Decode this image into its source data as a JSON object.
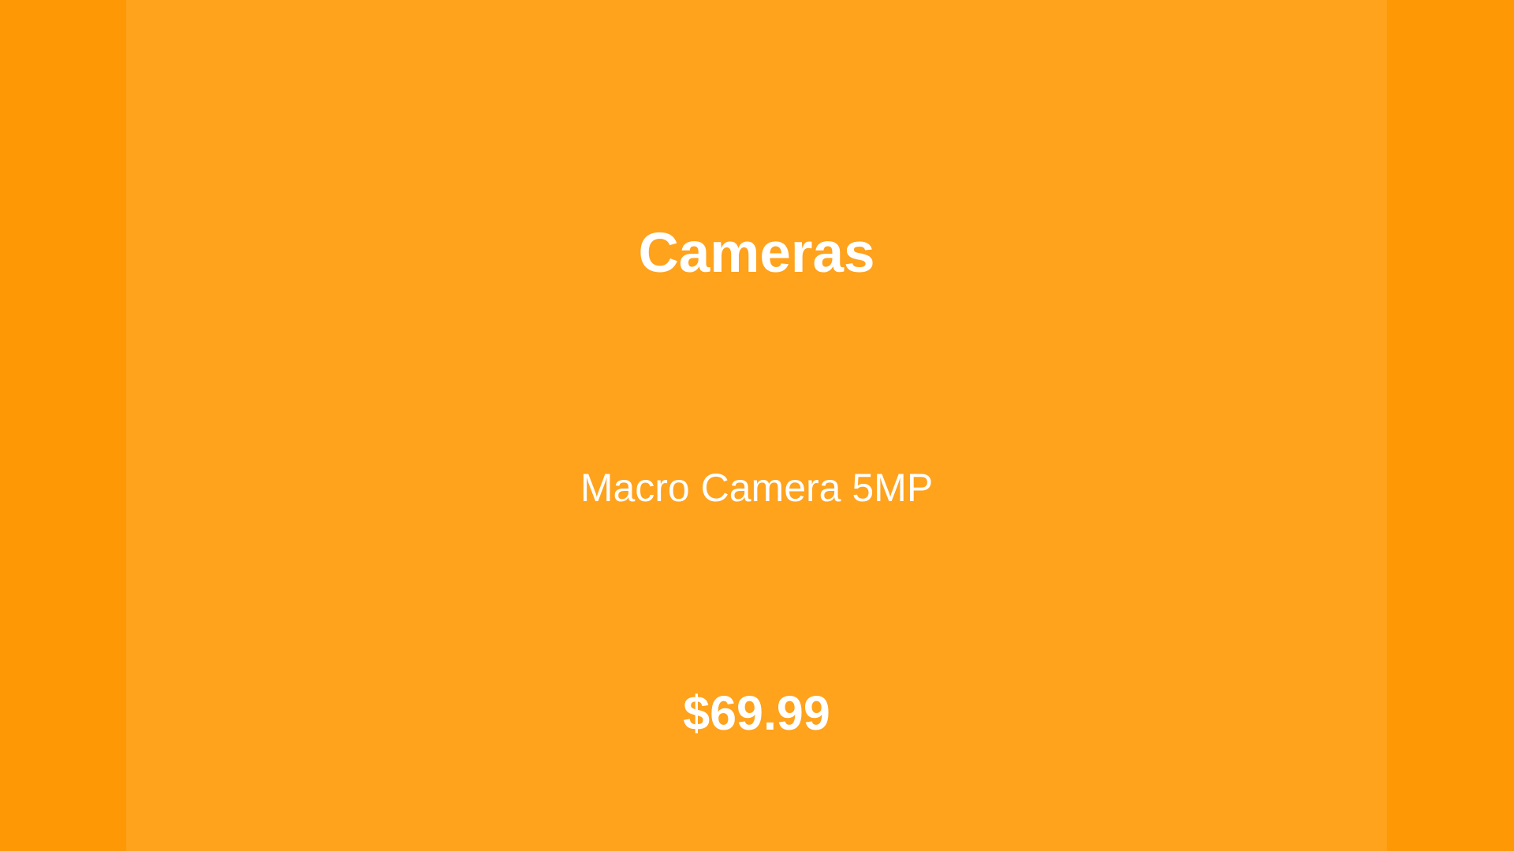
{
  "product_card": {
    "category": "Cameras",
    "name": "Macro Camera 5MP",
    "price": "$69.99"
  },
  "colors": {
    "outer_background": "#FF9805",
    "panel_background": "#FFA21C",
    "text": "#FFFFFF"
  }
}
